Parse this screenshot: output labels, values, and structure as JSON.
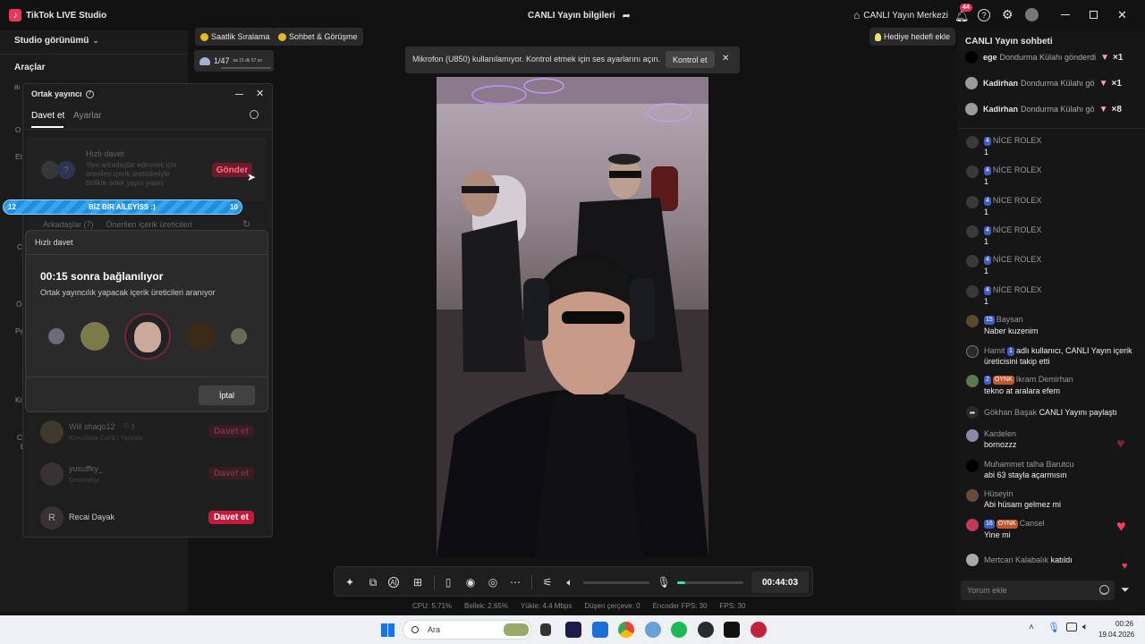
{
  "app": {
    "title": "TikTok LIVE Studio",
    "center_title": "CANLI Yayın bilgileri",
    "center_btn": "CANLI Yayın Merkezi",
    "notif_count": "44"
  },
  "left": {
    "studio_view": "Studio görünümü",
    "tools": "Araçlar",
    "stub_labels": [
      "Bi",
      "O",
      "Et",
      "C",
      "Ö",
      "Pa",
      "Ki",
      "C",
      "b"
    ]
  },
  "top_pills": {
    "rank": "Saatlik Sıralama",
    "chat": "Sohbet & Görüşme",
    "gift_goal": "Hediye hedefi ekle",
    "stat_main": "1/47",
    "stat_time": "sa 15 dk 57 sn"
  },
  "notification": {
    "text": "Mikrofon (U850) kullanılamıyor. Kontrol etmek için ses ayarlarını açın.",
    "button": "Kontrol et"
  },
  "cohost": {
    "title": "Ortak yayıncı",
    "tab_invite": "Davet et",
    "tab_settings": "Ayarlar",
    "quick_title": "Hızlı davet",
    "quick_desc": "Yeni arkadaşlar edinmek için önerilen içerik üreticileriyle birlikte ortak yayın yapın",
    "send": "Gönder",
    "friends_tab": "Arkadaşlar (7)",
    "suggested_tab": "Önerilen içerik üreticileri",
    "rows": [
      {
        "name": "Wiil shaqo12",
        "count": "3",
        "sub": "Konuklarla CANLI Yayında",
        "btn": "Davet et"
      },
      {
        "name": "yusuffky_",
        "count": "",
        "sub": "Çevrimdışı",
        "btn": "Davet et"
      },
      {
        "name": "Recai Dayak",
        "count": "",
        "sub": "",
        "btn": "Davet et",
        "initial": "R"
      }
    ]
  },
  "banner": {
    "left": "12",
    "text": "BİZ BİR AİLEYİSS :)",
    "right": "10",
    "progress": 1.0
  },
  "popup": {
    "header": "Hızlı davet",
    "title": "00:15 sonra bağlanılıyor",
    "subtitle": "Ortak yayıncılık yapacak içerik üreticileri aranıyor",
    "cancel": "İptal"
  },
  "chat": {
    "title": "CANLI Yayın sohbeti",
    "gifts": [
      {
        "user": "ege",
        "text": "Dondurma Külahı gönderdi",
        "count": "×1"
      },
      {
        "user": "Kadirhan",
        "text": "Dondurma Külahı gö",
        "count": "×1"
      },
      {
        "user": "Kadirhan",
        "text": "Dondurma Külahı gö",
        "count": "×8"
      }
    ],
    "messages": [
      {
        "badge": "4",
        "user": "NİCE ROLEX",
        "text": "1"
      },
      {
        "badge": "4",
        "user": "NİCE ROLEX",
        "text": "1"
      },
      {
        "badge": "4",
        "user": "NİCE ROLEX",
        "text": "1"
      },
      {
        "badge": "4",
        "user": "NİCE ROLEX",
        "text": "1"
      },
      {
        "badge": "4",
        "user": "NİCE ROLEX",
        "text": "1"
      },
      {
        "badge": "4",
        "user": "NİCE ROLEX",
        "text": "1"
      },
      {
        "badge": "15",
        "user": "Baysan",
        "text": "Naber kuzenim"
      }
    ],
    "follow": {
      "user": "Hamit",
      "badge": "1",
      "text": "adlı kullanıcı, CANLI Yayın içerik üreticisini takip etti"
    },
    "ikram": {
      "badge": "2",
      "team": "OYNK",
      "user": "Ikram Demirhan",
      "text": "tekno at aralara efem"
    },
    "share": {
      "user": "Gökhan Başak",
      "text": "CANLI Yayını paylaştı"
    },
    "kardelen": {
      "user": "Kardelen",
      "text": "bornozzz"
    },
    "talha": {
      "user": "Muhammet talha Barutcu",
      "text": "abi 63 stayla açarmısın"
    },
    "huseyin": {
      "user": "Hüseyin",
      "text": "Abi hüsam gelmez mi"
    },
    "cansel": {
      "badge": "16",
      "team": "OYNK",
      "user": "Cansel",
      "text": "Yine mi"
    },
    "mertcan": {
      "user": "Mertcan Kalabalık",
      "text": "katıldı"
    },
    "input_placeholder": "Yorum ekle"
  },
  "toolbar": {
    "timer": "00:44:03",
    "mic_level": 0.12,
    "volume_level": 0.0
  },
  "status": {
    "cpu": "CPU: 5.71%",
    "memory": "Bellek: 2.65%",
    "upload": "Yükle: 4.4 Mbps",
    "dropped": "Düşen çerçeve: 0",
    "encoder": "Encoder FPS: 30",
    "fps": "FPS: 30"
  },
  "taskbar": {
    "search": "Ara",
    "time": "00:26",
    "date": "19.04.2026"
  },
  "colors": {
    "accent": "#fe2c55",
    "bg": "#121212",
    "panel": "#1b1b1b",
    "banner": "#1f8fe0"
  }
}
